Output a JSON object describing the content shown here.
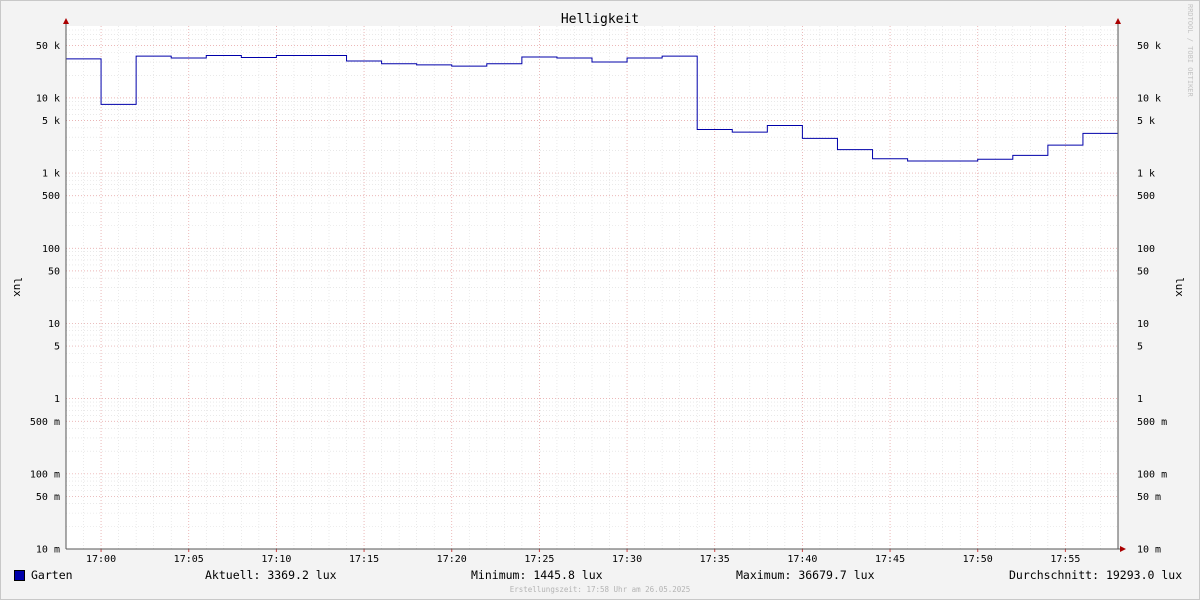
{
  "chart_data": {
    "type": "line",
    "title": "Helligkeit",
    "ylabel": "lux",
    "yscale": "log",
    "ylim": [
      0.01,
      80000
    ],
    "grid": true,
    "legend_position": "bottom-left",
    "credit": "RRDTOOL / TOBI OETIKER",
    "x_start": "16:58",
    "x_end": "17:58",
    "x_ticks": [
      "17:00",
      "17:05",
      "17:10",
      "17:15",
      "17:20",
      "17:25",
      "17:30",
      "17:35",
      "17:40",
      "17:45",
      "17:50",
      "17:55"
    ],
    "y_ticks": [
      {
        "value": 50000,
        "label": "50 k"
      },
      {
        "value": 10000,
        "label": "10 k"
      },
      {
        "value": 5000,
        "label": "5 k"
      },
      {
        "value": 1000,
        "label": "1 k"
      },
      {
        "value": 500,
        "label": "500"
      },
      {
        "value": 100,
        "label": "100"
      },
      {
        "value": 50,
        "label": "50"
      },
      {
        "value": 10,
        "label": "10"
      },
      {
        "value": 5,
        "label": "5"
      },
      {
        "value": 1,
        "label": "1"
      },
      {
        "value": 0.5,
        "label": "500 m"
      },
      {
        "value": 0.1,
        "label": "100 m"
      },
      {
        "value": 0.05,
        "label": "50 m"
      },
      {
        "value": 0.01,
        "label": "10 m"
      }
    ],
    "series": [
      {
        "name": "Garten",
        "color": "#0000aa",
        "step": true,
        "points": [
          [
            "16:58",
            33000
          ],
          [
            "17:00",
            8200
          ],
          [
            "17:02",
            36000
          ],
          [
            "17:04",
            34000
          ],
          [
            "17:06",
            36700
          ],
          [
            "17:08",
            34500
          ],
          [
            "17:10",
            36700
          ],
          [
            "17:14",
            31000
          ],
          [
            "17:16",
            28500
          ],
          [
            "17:18",
            27500
          ],
          [
            "17:20",
            26500
          ],
          [
            "17:22",
            28500
          ],
          [
            "17:24",
            35000
          ],
          [
            "17:26",
            34000
          ],
          [
            "17:28",
            30000
          ],
          [
            "17:30",
            34000
          ],
          [
            "17:32",
            36000
          ],
          [
            "17:34",
            3800
          ],
          [
            "17:36",
            3500
          ],
          [
            "17:38",
            4300
          ],
          [
            "17:40",
            2900
          ],
          [
            "17:42",
            2050
          ],
          [
            "17:44",
            1550
          ],
          [
            "17:46",
            1445.8
          ],
          [
            "17:50",
            1530
          ],
          [
            "17:52",
            1720
          ],
          [
            "17:54",
            2350
          ],
          [
            "17:56",
            3369.2
          ],
          [
            "17:58",
            3369.2
          ]
        ]
      }
    ]
  },
  "legend": {
    "series_name": "Garten",
    "swatch_color": "#0000aa"
  },
  "stats": {
    "current_label": "Aktuell:",
    "current_value": "3369.2 lux",
    "min_label": "Minimum:",
    "min_value": "1445.8 lux",
    "max_label": "Maximum:",
    "max_value": "36679.7 lux",
    "avg_label": "Durchschnitt:",
    "avg_value": "19293.0 lux"
  },
  "footer": {
    "timestamp": "Erstellungszeit: 17:58 Uhr am 26.05.2025"
  }
}
